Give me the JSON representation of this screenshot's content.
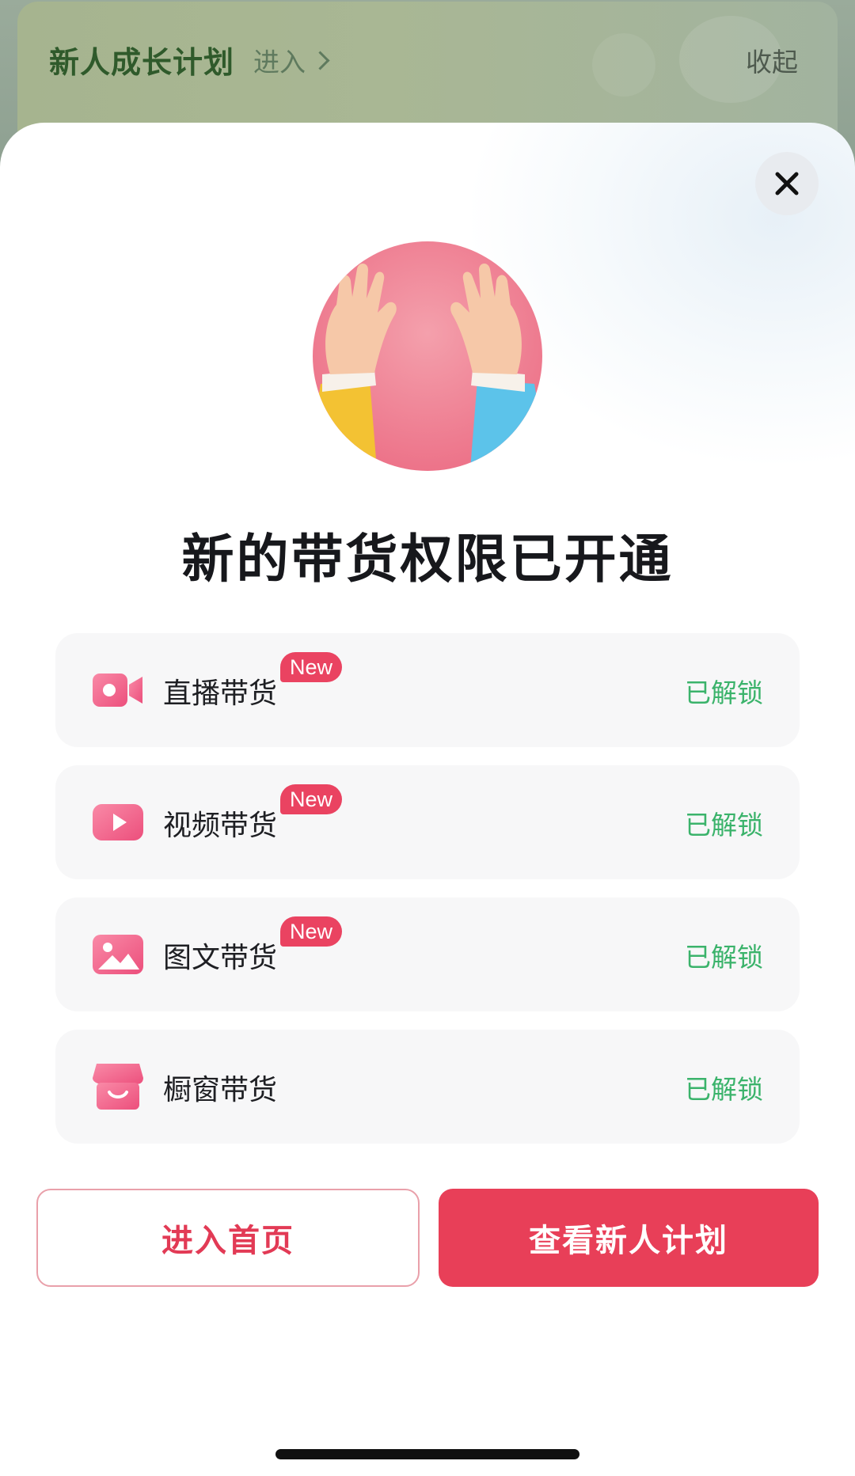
{
  "background": {
    "growth_plan_title": "新人成长计划",
    "enter_label": "进入",
    "collapse_label": "收起"
  },
  "sheet": {
    "close_icon": "close-icon",
    "hero_image": "raised-hands-illustration",
    "title": "新的带货权限已开通",
    "permissions": [
      {
        "label": "直播带货",
        "badge": "New",
        "status": "已解锁",
        "icon": "video-camera-icon"
      },
      {
        "label": "视频带货",
        "badge": "New",
        "status": "已解锁",
        "icon": "play-video-icon"
      },
      {
        "label": "图文带货",
        "badge": "New",
        "status": "已解锁",
        "icon": "image-icon"
      },
      {
        "label": "橱窗带货",
        "badge": "",
        "status": "已解锁",
        "icon": "storefront-icon"
      }
    ],
    "buttons": {
      "home": "进入首页",
      "plan": "查看新人计划"
    }
  },
  "colors": {
    "accent": "#e83f58",
    "unlocked": "#3bb36b",
    "badge": "#ea4361",
    "growth_title": "#2f5a2b"
  }
}
